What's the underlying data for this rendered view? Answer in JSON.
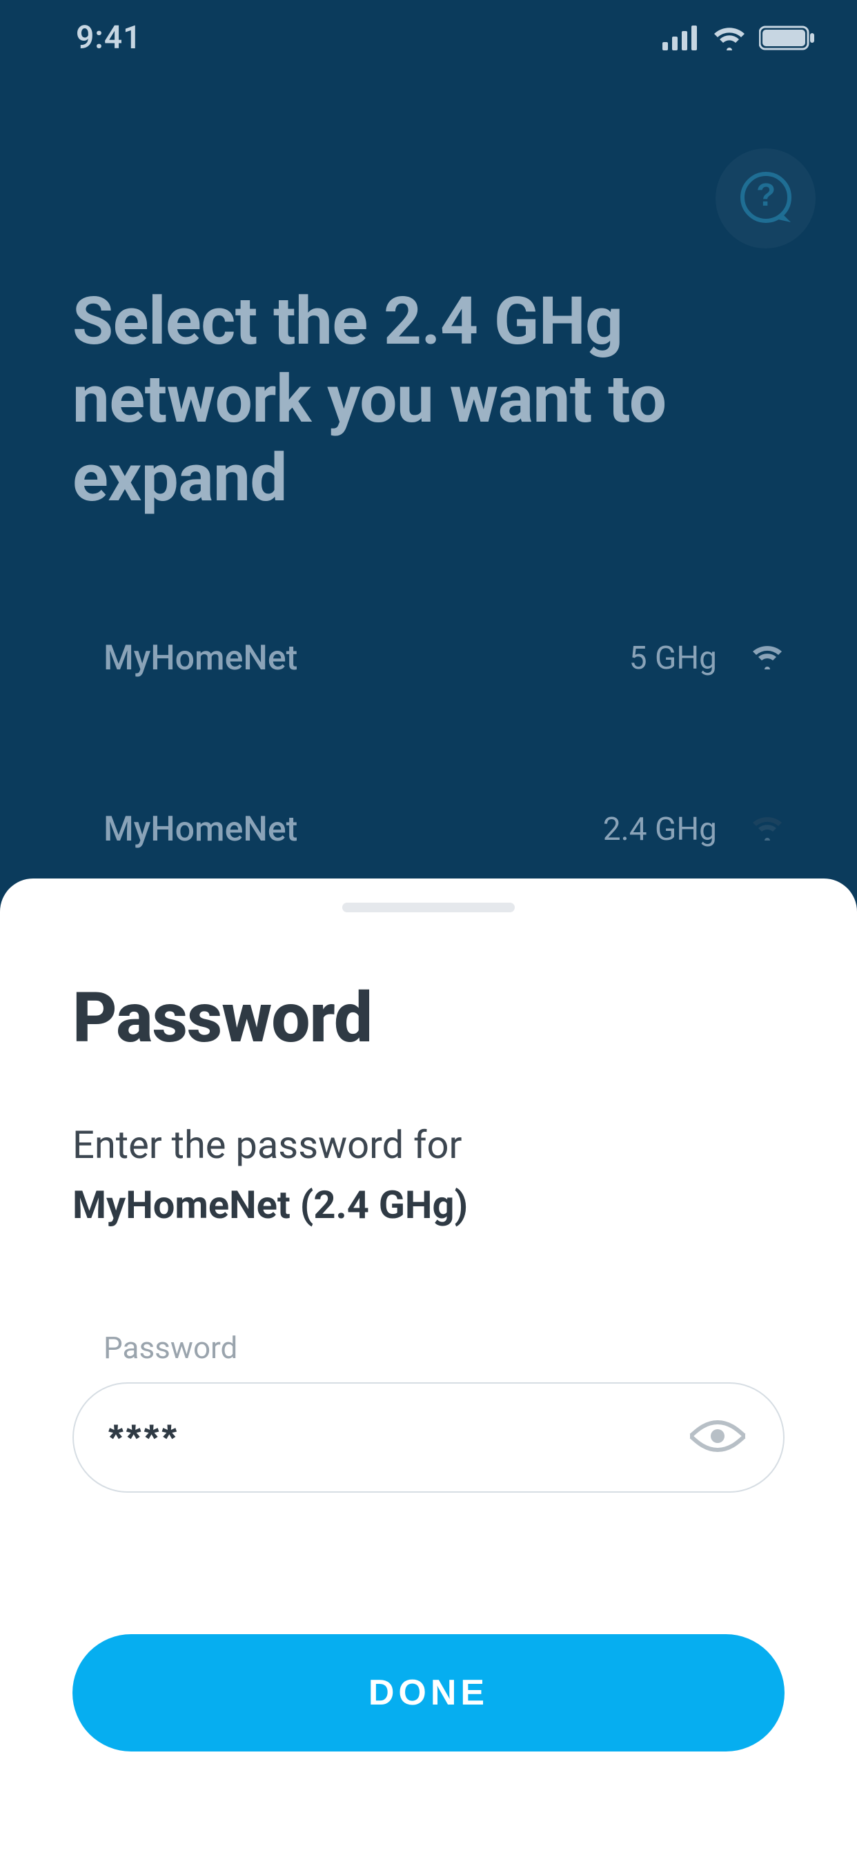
{
  "status": {
    "time": "9:41"
  },
  "header": {
    "title": "Select the 2.4 GHg network you want to expand"
  },
  "networks": [
    {
      "name": "MyHomeNet",
      "band": "5 GHg",
      "signal": "strong"
    },
    {
      "name": "MyHomeNet",
      "band": "2.4 GHg",
      "signal": "weak"
    }
  ],
  "sheet": {
    "title": "Password",
    "subtitle_prefix": "Enter the password for",
    "network_label": "MyHomeNet (2.4 GHg)",
    "field_label": "Password",
    "password_value": "****",
    "done_label": "DONE"
  }
}
